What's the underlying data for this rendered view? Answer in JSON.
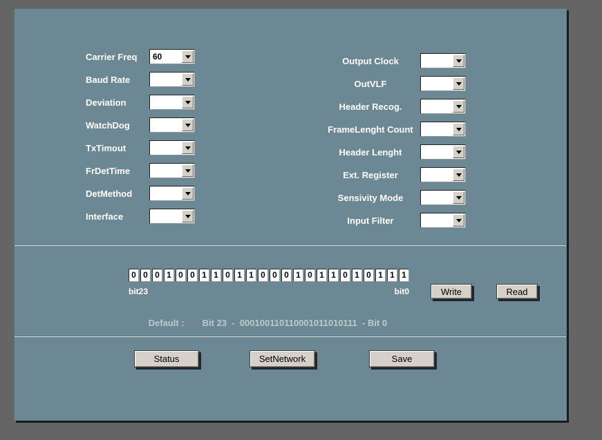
{
  "fields_left": [
    {
      "label": "Carrier Freq",
      "value": "60"
    },
    {
      "label": "Baud Rate",
      "value": ""
    },
    {
      "label": "Deviation",
      "value": ""
    },
    {
      "label": "WatchDog",
      "value": ""
    },
    {
      "label": "TxTimout",
      "value": ""
    },
    {
      "label": "FrDetTime",
      "value": ""
    },
    {
      "label": "DetMethod",
      "value": ""
    },
    {
      "label": "Interface",
      "value": ""
    }
  ],
  "fields_right": [
    {
      "label": "Output Clock",
      "value": ""
    },
    {
      "label": "OutVLF",
      "value": ""
    },
    {
      "label": "Header Recog.",
      "value": ""
    },
    {
      "label": "FrameLenght Count",
      "value": ""
    },
    {
      "label": "Header Lenght",
      "value": ""
    },
    {
      "label": "Ext. Register",
      "value": ""
    },
    {
      "label": "Sensivity Mode",
      "value": ""
    },
    {
      "label": "Input Filter",
      "value": ""
    }
  ],
  "bit_register": {
    "bits_msb_first": [
      "0",
      "0",
      "0",
      "1",
      "0",
      "0",
      "1",
      "1",
      "0",
      "1",
      "1",
      "0",
      "0",
      "0",
      "1",
      "0",
      "1",
      "1",
      "0",
      "1",
      "0",
      "1",
      "1",
      "1"
    ],
    "msb_label": "bit23",
    "lsb_label": "bit0",
    "write_button": "Write",
    "read_button": "Read",
    "default_label": "Default :",
    "default_value": "Bit 23  -  000100110110001011010111  - Bit 0"
  },
  "actions": {
    "status_button": "Status",
    "set_network_button": "SetNetwork",
    "save_button": "Save"
  },
  "colors": {
    "desktop_bg": "#656565",
    "panel_bg": "#6c8894",
    "label_text": "#ffffff",
    "muted_text": "#bdc9cd",
    "button_face": "#d5d1c8",
    "field_bg": "#ffffff"
  }
}
